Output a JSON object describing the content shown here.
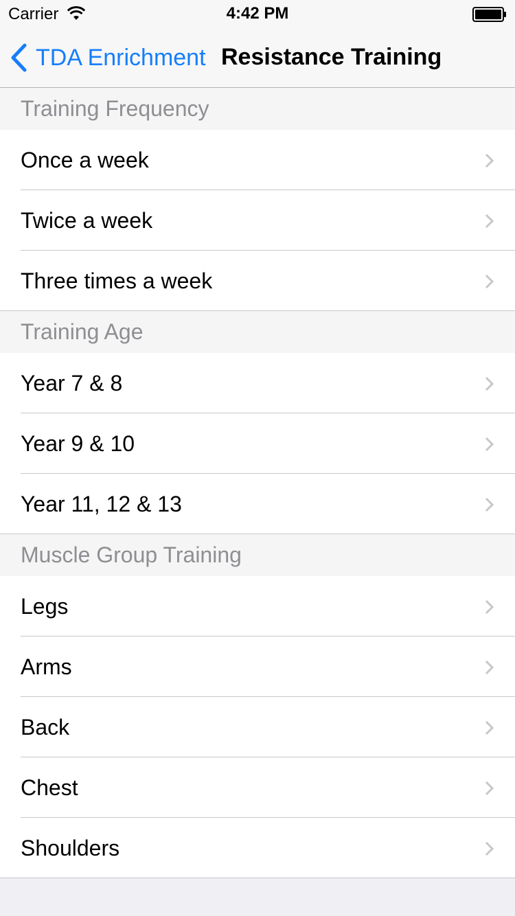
{
  "status_bar": {
    "carrier": "Carrier",
    "time": "4:42 PM"
  },
  "nav": {
    "back_label": "TDA Enrichment",
    "title": "Resistance Training",
    "accent_color": "#157efb"
  },
  "sections": [
    {
      "header": "Training Frequency",
      "items": [
        "Once a week",
        "Twice a week",
        "Three times a week"
      ]
    },
    {
      "header": "Training Age",
      "items": [
        "Year 7 & 8",
        "Year 9 & 10",
        "Year 11, 12 & 13"
      ]
    },
    {
      "header": "Muscle Group Training",
      "items": [
        "Legs",
        "Arms",
        "Back",
        "Chest",
        "Shoulders"
      ]
    }
  ]
}
